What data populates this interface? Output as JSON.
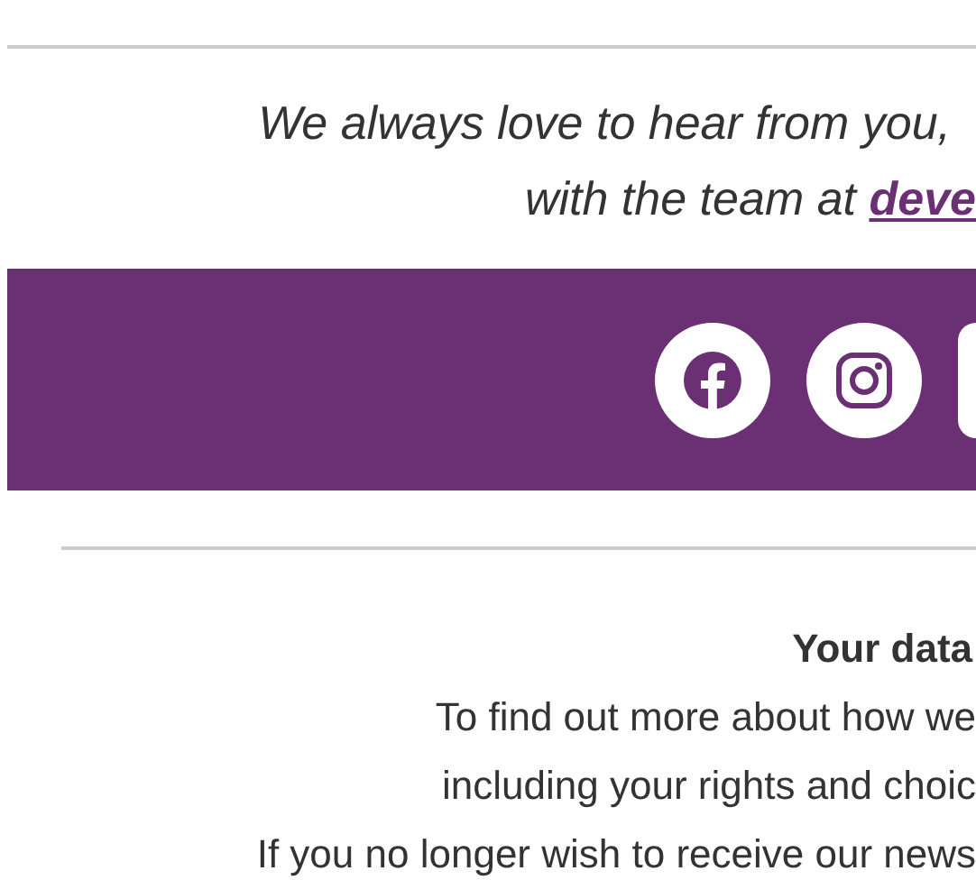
{
  "message": {
    "lines": [
      "We always love to hear from you,",
      "with the team at"
    ],
    "link": "deve"
  },
  "social_links": [
    {
      "kind": "facebook"
    },
    {
      "kind": "instagram"
    },
    {
      "kind": "partial"
    }
  ],
  "data_section": {
    "title": "Your data",
    "lines": [
      "To find out more about how we",
      "including your rights and choic",
      "If you no longer wish to receive our news"
    ]
  }
}
